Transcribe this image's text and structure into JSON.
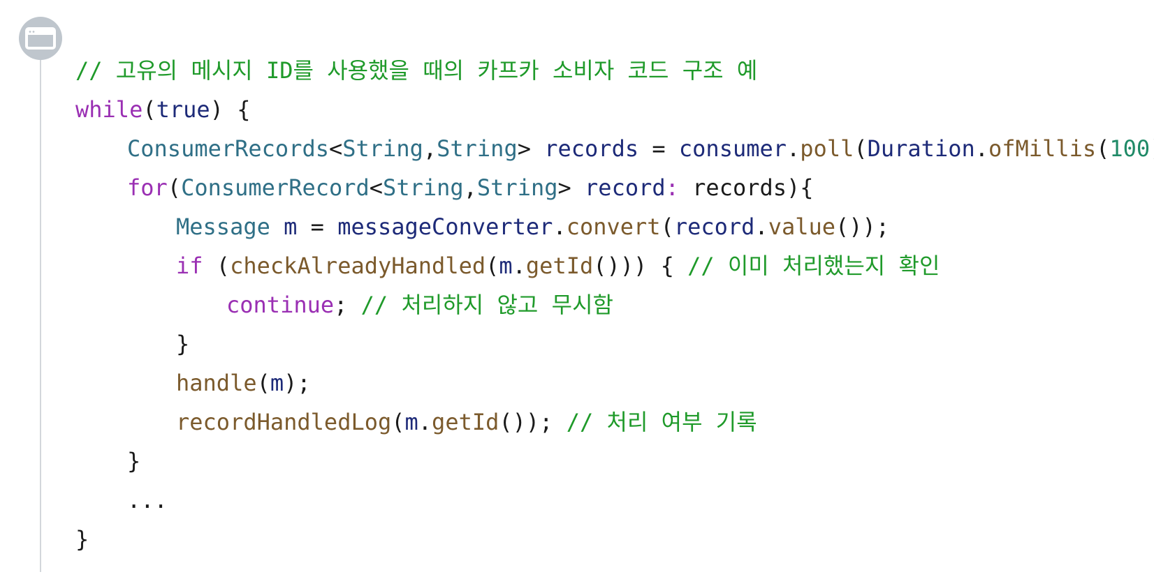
{
  "colors": {
    "comment": "#1f9a2a",
    "keyword": "#9a2fb3",
    "type": "#2f6f86",
    "function": "#7b5a2c",
    "variable": "#1d2a78",
    "number": "#1f8a67",
    "text": "#1a1a1a",
    "gutter": "#d3d7db",
    "badge": "#bfc6cd"
  },
  "badge": {
    "icon": "browser-window-icon"
  },
  "code": {
    "lines": [
      {
        "indent": 0,
        "tokens": [
          {
            "t": "cm",
            "v": "// 고유의 메시지 ID를 사용했을 때의 카프카 소비자 코드 구조 예"
          }
        ]
      },
      {
        "indent": 0,
        "tokens": [
          {
            "t": "kw",
            "v": "while"
          },
          {
            "t": "pu",
            "v": "("
          },
          {
            "t": "var",
            "v": "true"
          },
          {
            "t": "pu",
            "v": ") {"
          }
        ]
      },
      {
        "indent": 1,
        "tokens": [
          {
            "t": "ty",
            "v": "ConsumerRecords"
          },
          {
            "t": "pu",
            "v": "<"
          },
          {
            "t": "ty",
            "v": "String"
          },
          {
            "t": "pu",
            "v": ","
          },
          {
            "t": "ty",
            "v": "String"
          },
          {
            "t": "pu",
            "v": "> "
          },
          {
            "t": "var",
            "v": "records"
          },
          {
            "t": "pu",
            "v": " = "
          },
          {
            "t": "var",
            "v": "consumer"
          },
          {
            "t": "pu",
            "v": "."
          },
          {
            "t": "fn",
            "v": "poll"
          },
          {
            "t": "pu",
            "v": "("
          },
          {
            "t": "var",
            "v": "Duration"
          },
          {
            "t": "pu",
            "v": "."
          },
          {
            "t": "fn",
            "v": "ofMillis"
          },
          {
            "t": "pu",
            "v": "("
          },
          {
            "t": "num",
            "v": "100"
          },
          {
            "t": "pu",
            "v": "));"
          }
        ]
      },
      {
        "indent": 1,
        "tokens": [
          {
            "t": "kw",
            "v": "for"
          },
          {
            "t": "pu",
            "v": "("
          },
          {
            "t": "ty",
            "v": "ConsumerRecord"
          },
          {
            "t": "pu",
            "v": "<"
          },
          {
            "t": "ty",
            "v": "String"
          },
          {
            "t": "pu",
            "v": ","
          },
          {
            "t": "ty",
            "v": "String"
          },
          {
            "t": "pu",
            "v": "> "
          },
          {
            "t": "var",
            "v": "record"
          },
          {
            "t": "kw",
            "v": ":"
          },
          {
            "t": "pl",
            "v": " records){"
          }
        ]
      },
      {
        "indent": 2,
        "tokens": [
          {
            "t": "ty",
            "v": "Message"
          },
          {
            "t": "pu",
            "v": " "
          },
          {
            "t": "var",
            "v": "m"
          },
          {
            "t": "pu",
            "v": " = "
          },
          {
            "t": "var",
            "v": "messageConverter"
          },
          {
            "t": "pu",
            "v": "."
          },
          {
            "t": "fn",
            "v": "convert"
          },
          {
            "t": "pu",
            "v": "("
          },
          {
            "t": "var",
            "v": "record"
          },
          {
            "t": "pu",
            "v": "."
          },
          {
            "t": "fn",
            "v": "value"
          },
          {
            "t": "pu",
            "v": "());"
          }
        ]
      },
      {
        "indent": 2,
        "tokens": [
          {
            "t": "kw",
            "v": "if"
          },
          {
            "t": "pu",
            "v": " ("
          },
          {
            "t": "fn",
            "v": "checkAlreadyHandled"
          },
          {
            "t": "pu",
            "v": "("
          },
          {
            "t": "var",
            "v": "m"
          },
          {
            "t": "pu",
            "v": "."
          },
          {
            "t": "fn",
            "v": "getId"
          },
          {
            "t": "pu",
            "v": "())) { "
          },
          {
            "t": "cm",
            "v": "// 이미 처리했는지 확인"
          }
        ]
      },
      {
        "indent": 3,
        "tokens": [
          {
            "t": "kw",
            "v": "continue"
          },
          {
            "t": "pu",
            "v": "; "
          },
          {
            "t": "cm",
            "v": "// 처리하지 않고 무시함"
          }
        ]
      },
      {
        "indent": 2,
        "tokens": [
          {
            "t": "pu",
            "v": "}"
          }
        ]
      },
      {
        "indent": 2,
        "tokens": [
          {
            "t": "fn",
            "v": "handle"
          },
          {
            "t": "pu",
            "v": "("
          },
          {
            "t": "var",
            "v": "m"
          },
          {
            "t": "pu",
            "v": ");"
          }
        ]
      },
      {
        "indent": 2,
        "tokens": [
          {
            "t": "fn",
            "v": "recordHandledLog"
          },
          {
            "t": "pu",
            "v": "("
          },
          {
            "t": "var",
            "v": "m"
          },
          {
            "t": "pu",
            "v": "."
          },
          {
            "t": "fn",
            "v": "getId"
          },
          {
            "t": "pu",
            "v": "()); "
          },
          {
            "t": "cm",
            "v": "// 처리 여부 기록"
          }
        ]
      },
      {
        "indent": 1,
        "tokens": [
          {
            "t": "pu",
            "v": "}"
          }
        ]
      },
      {
        "indent": 1,
        "tokens": [
          {
            "t": "pu",
            "v": "..."
          }
        ]
      },
      {
        "indent": 0,
        "tokens": [
          {
            "t": "pu",
            "v": "}"
          }
        ]
      }
    ]
  }
}
